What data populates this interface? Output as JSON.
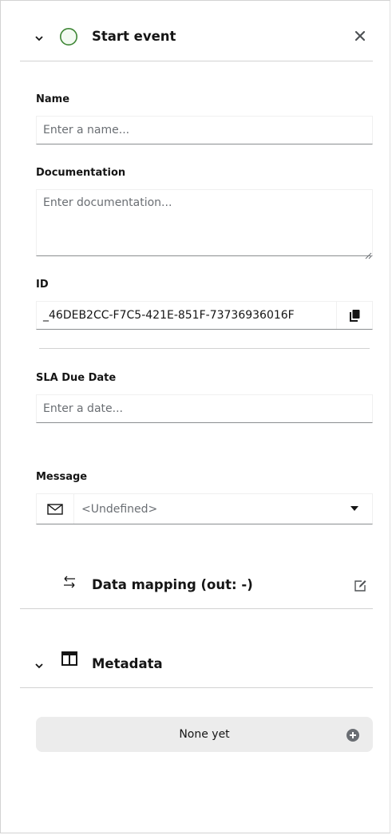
{
  "header": {
    "title": "Start event",
    "colors": {
      "event_circle_stroke": "#3e8635",
      "event_circle_fill": "#f3faf2"
    }
  },
  "form": {
    "name": {
      "label": "Name",
      "placeholder": "Enter a name..."
    },
    "documentation": {
      "label": "Documentation",
      "placeholder": "Enter documentation..."
    },
    "id": {
      "label": "ID",
      "value": "_46DEB2CC-F7C5-421E-851F-73736936016F"
    },
    "sla": {
      "label": "SLA Due Date",
      "placeholder": "Enter a date..."
    },
    "message": {
      "label": "Message",
      "selected": "<Undefined>"
    }
  },
  "data_mapping": {
    "title": "Data mapping (out: -)"
  },
  "metadata": {
    "title": "Metadata",
    "empty_label": "None yet"
  },
  "icons": {
    "collapse": "chevron-down-icon",
    "close": "close-icon",
    "copy": "copy-icon",
    "message": "envelope-icon",
    "dropdown": "caret-down-icon",
    "data_mapping": "swap-arrows-icon",
    "edit": "edit-icon",
    "metadata": "table-columns-icon",
    "add": "plus-circle-icon"
  }
}
